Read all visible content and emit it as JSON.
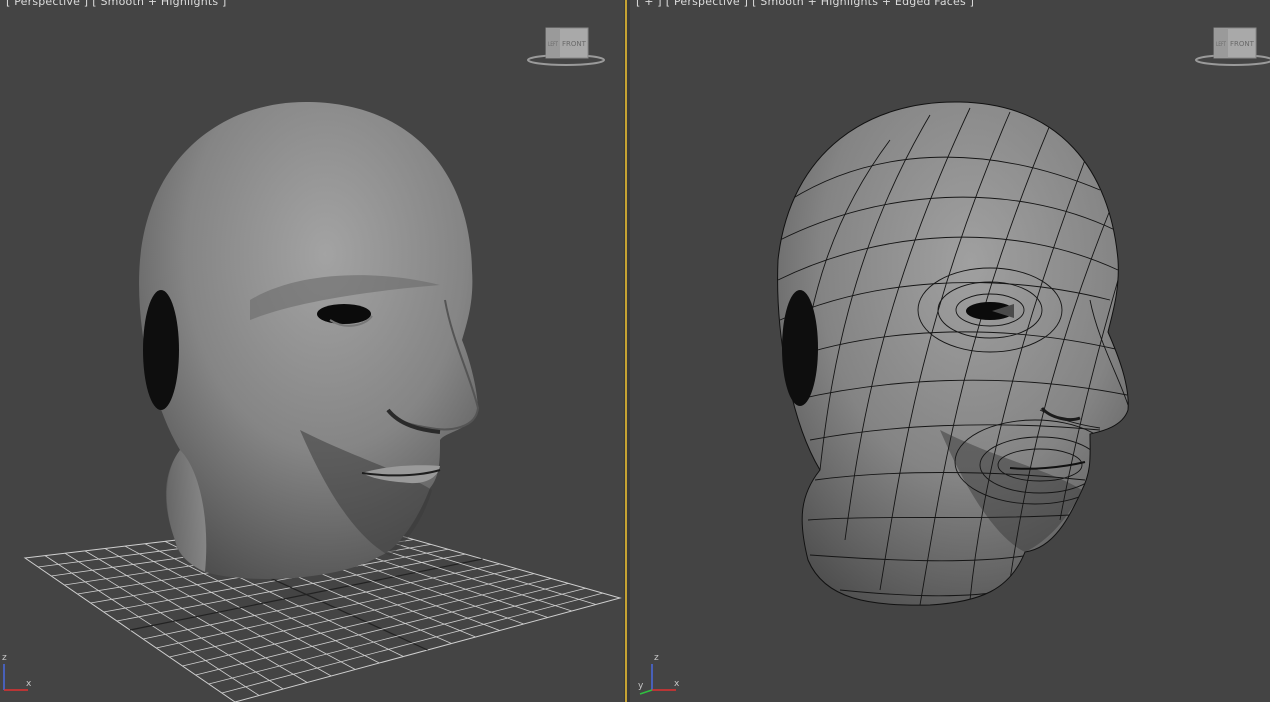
{
  "left_viewport": {
    "label_parts": [
      "[ Perspective ]",
      "[ Smooth + Highlights ]"
    ],
    "viewcube_face": "FRONT",
    "viewcube_side": "LEFT",
    "axis": {
      "z": "z",
      "x": "x"
    }
  },
  "right_viewport": {
    "label_parts": [
      "[ + ]",
      "[ Perspective ]",
      "[ Smooth + Highlights + Edged Faces ]"
    ],
    "viewcube_face": "FRONT",
    "viewcube_side": "LEFT",
    "axis": {
      "z": "z",
      "y": "y",
      "x": "x"
    }
  },
  "colors": {
    "viewport_bg": "#444444",
    "active_border": "#c5a233",
    "mesh_grey": "#8a8a8a",
    "wire": "#111111"
  }
}
